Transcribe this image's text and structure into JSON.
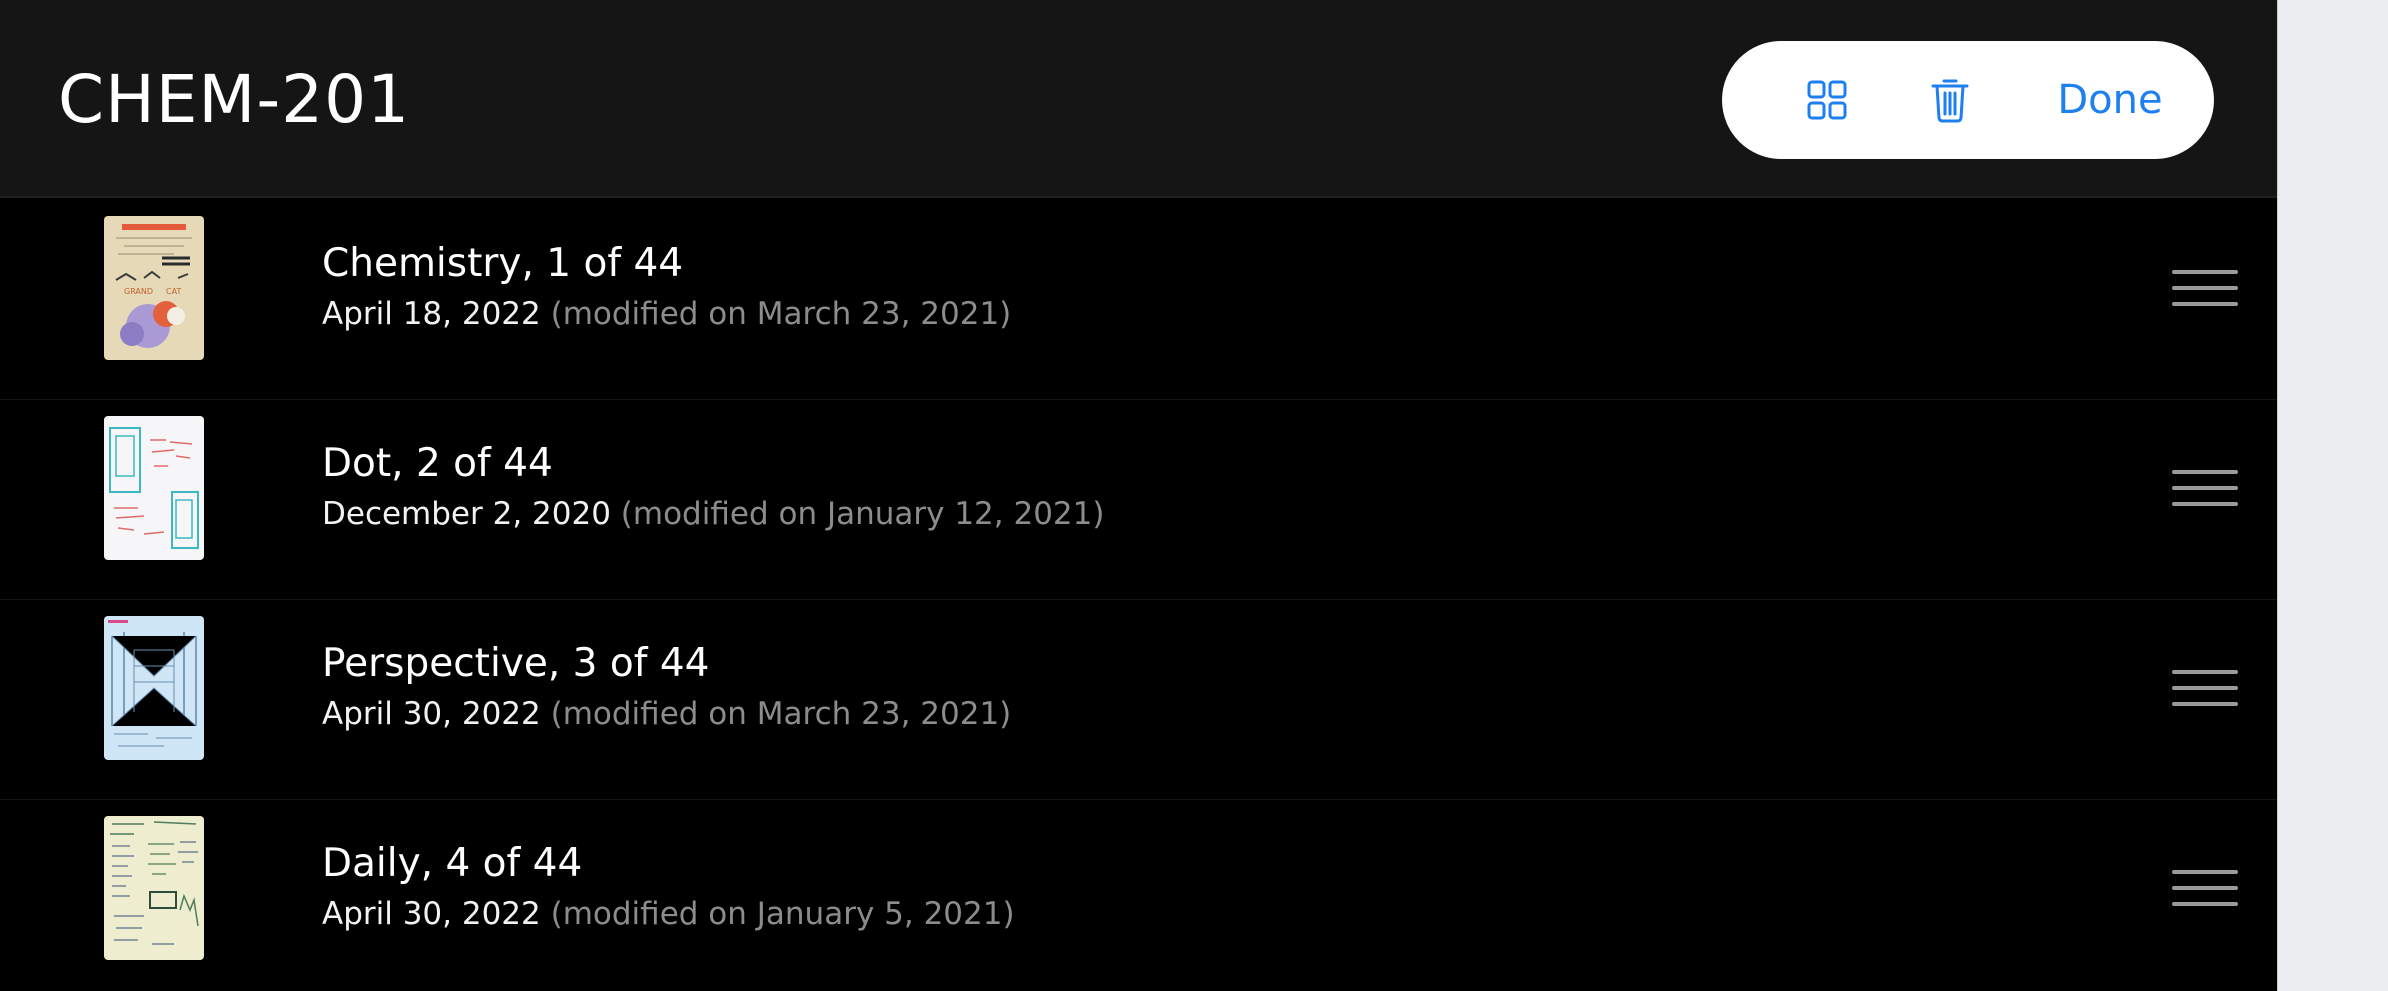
{
  "header": {
    "title": "CHEM-201",
    "toolbar": {
      "grid_icon": "grid-icon",
      "trash_icon": "trash-icon",
      "done_label": "Done",
      "accent_color": "#1e7ff0"
    }
  },
  "notebooks": [
    {
      "title": "Chemistry, 1 of 44",
      "date": "April 18, 2022",
      "modified": "(modified on March 23, 2021)",
      "thumbnail": "chemistry-cover"
    },
    {
      "title": "Dot, 2 of 44",
      "date": "December 2, 2020",
      "modified": "(modified on January 12, 2021)",
      "thumbnail": "dot-cover"
    },
    {
      "title": "Perspective, 3 of 44",
      "date": "April 30, 2022",
      "modified": "(modified on March 23, 2021)",
      "thumbnail": "perspective-cover"
    },
    {
      "title": "Daily, 4 of 44",
      "date": "April 30, 2022",
      "modified": "(modified on January 5, 2021)",
      "thumbnail": "daily-cover"
    }
  ],
  "colors": {
    "background": "#000000",
    "header_background": "#151515",
    "secondary_text": "#8c8c8c"
  }
}
